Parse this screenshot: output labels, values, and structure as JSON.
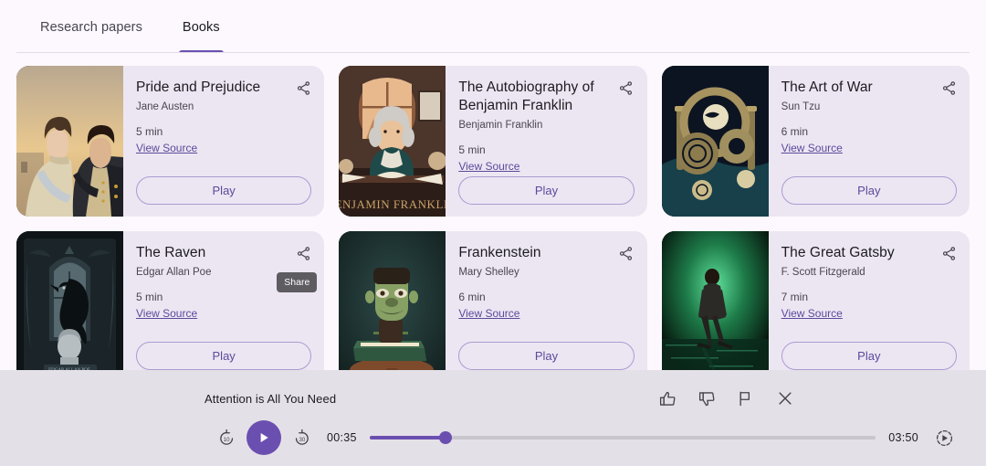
{
  "theme": {
    "page_bg": "#FCF8FD",
    "card_bg": "#ECE6F3",
    "accent": "#6B4FB0",
    "link": "#5B4A9B",
    "player_bg": "#E4E0E7",
    "tooltip_bg": "#5E5B61"
  },
  "tabs": [
    {
      "label": "Research papers",
      "active": false
    },
    {
      "label": "Books",
      "active": true
    }
  ],
  "cards": [
    {
      "title": "Pride and Prejudice",
      "author": "Jane Austen",
      "duration": "5 min",
      "source_label": "View Source",
      "play_label": "Play",
      "share_icon": "share-icon",
      "cover": "pride-and-prejudice-cover",
      "tooltip": null
    },
    {
      "title": "The Autobiography of Benjamin Franklin",
      "author": "Benjamin Franklin",
      "duration": "5 min",
      "source_label": "View Source",
      "play_label": "Play",
      "share_icon": "share-icon",
      "cover": "benjamin-franklin-cover",
      "tooltip": null
    },
    {
      "title": "The Art of War",
      "author": "Sun Tzu",
      "duration": "6 min",
      "source_label": "View Source",
      "play_label": "Play",
      "share_icon": "share-icon",
      "cover": "art-of-war-cover",
      "tooltip": null
    },
    {
      "title": "The Raven",
      "author": "Edgar Allan Poe",
      "duration": "5 min",
      "source_label": "View Source",
      "play_label": "Play",
      "share_icon": "share-icon",
      "cover": "the-raven-cover",
      "tooltip": "Share"
    },
    {
      "title": "Frankenstein",
      "author": "Mary Shelley",
      "duration": "6 min",
      "source_label": "View Source",
      "play_label": "Play",
      "share_icon": "share-icon",
      "cover": "frankenstein-cover",
      "tooltip": null
    },
    {
      "title": "The Great Gatsby",
      "author": "F. Scott Fitzgerald",
      "duration": "7 min",
      "source_label": "View Source",
      "play_label": "Play",
      "share_icon": "share-icon",
      "cover": "great-gatsby-cover",
      "tooltip": null
    }
  ],
  "player": {
    "title": "Attention is All You Need",
    "current_time": "00:35",
    "total_time": "03:50",
    "progress_percent": 15,
    "is_playing": false,
    "rewind_icon": "replay-10-icon",
    "rewind_label": "10",
    "forward_icon": "forward-30-icon",
    "forward_label": "30",
    "play_icon": "play-icon",
    "speed_icon": "playback-speed-icon",
    "actions": [
      {
        "icon": "thumb-up-icon",
        "name": "thumb-up-button"
      },
      {
        "icon": "thumb-down-icon",
        "name": "thumb-down-button"
      },
      {
        "icon": "flag-icon",
        "name": "report-button"
      },
      {
        "icon": "close-icon",
        "name": "close-player-button"
      }
    ]
  }
}
